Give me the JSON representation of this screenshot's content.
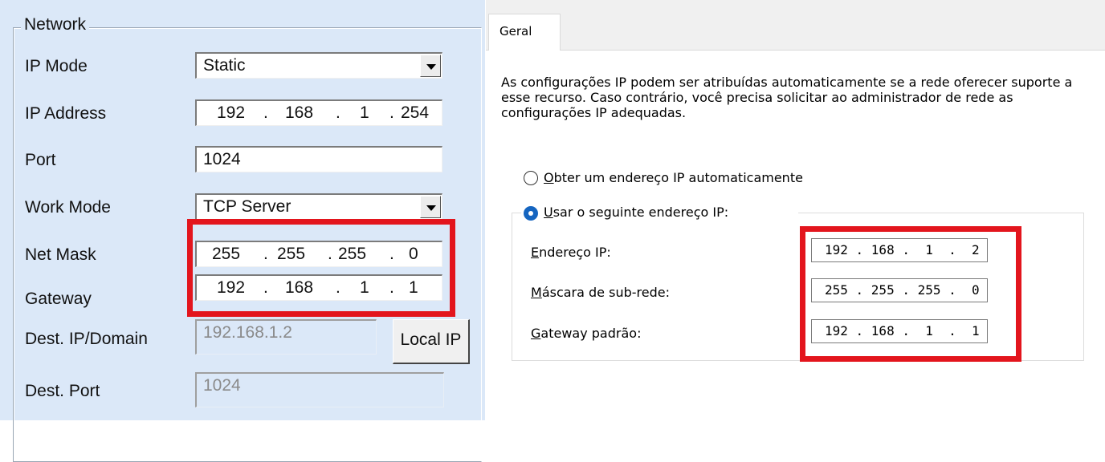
{
  "left_panel": {
    "group_title": "Network",
    "fields": {
      "ip_mode": {
        "label": "IP Mode",
        "value": "Static"
      },
      "ip_address": {
        "label": "IP Address",
        "octets": [
          "192",
          "168",
          "1",
          "254"
        ]
      },
      "port": {
        "label": "Port",
        "value": "1024"
      },
      "work_mode": {
        "label": "Work Mode",
        "value": "TCP Server"
      },
      "net_mask": {
        "label": "Net Mask",
        "octets": [
          "255",
          "255",
          "255",
          "0"
        ]
      },
      "gateway": {
        "label": "Gateway",
        "octets": [
          "192",
          "168",
          "1",
          "1"
        ]
      },
      "dest_ip": {
        "label": "Dest. IP/Domain",
        "value": "192.168.1.2"
      },
      "dest_port": {
        "label": "Dest. Port",
        "value": "1024"
      }
    },
    "local_ip_button": "Local IP"
  },
  "right_panel": {
    "tab_label": "Geral",
    "description": "As configurações IP podem ser atribuídas automaticamente se a rede oferecer suporte a esse recurso. Caso contrário, você precisa solicitar ao administrador de rede as configurações IP adequadas.",
    "radio_auto": {
      "label_first": "O",
      "label_rest": "bter um endereço IP automaticamente",
      "selected": false
    },
    "radio_manual": {
      "label_first": "U",
      "label_rest": "sar o seguinte endereço IP:",
      "selected": true
    },
    "ip_field": {
      "label_first": "E",
      "label_rest": "ndereço IP:",
      "value": "192 . 168 .  1  .  2"
    },
    "mask_field": {
      "label_first": "M",
      "label_rest": "áscara de sub-rede:",
      "value": "255 . 255 . 255 .  0"
    },
    "gateway_field": {
      "label_first": "G",
      "label_rest": "ateway padrão:",
      "value": "192 . 168 .  1  .  1"
    }
  },
  "colors": {
    "highlight": "#e3151d",
    "radio_selected": "#1565c0",
    "left_bg": "#dbe8f8"
  }
}
